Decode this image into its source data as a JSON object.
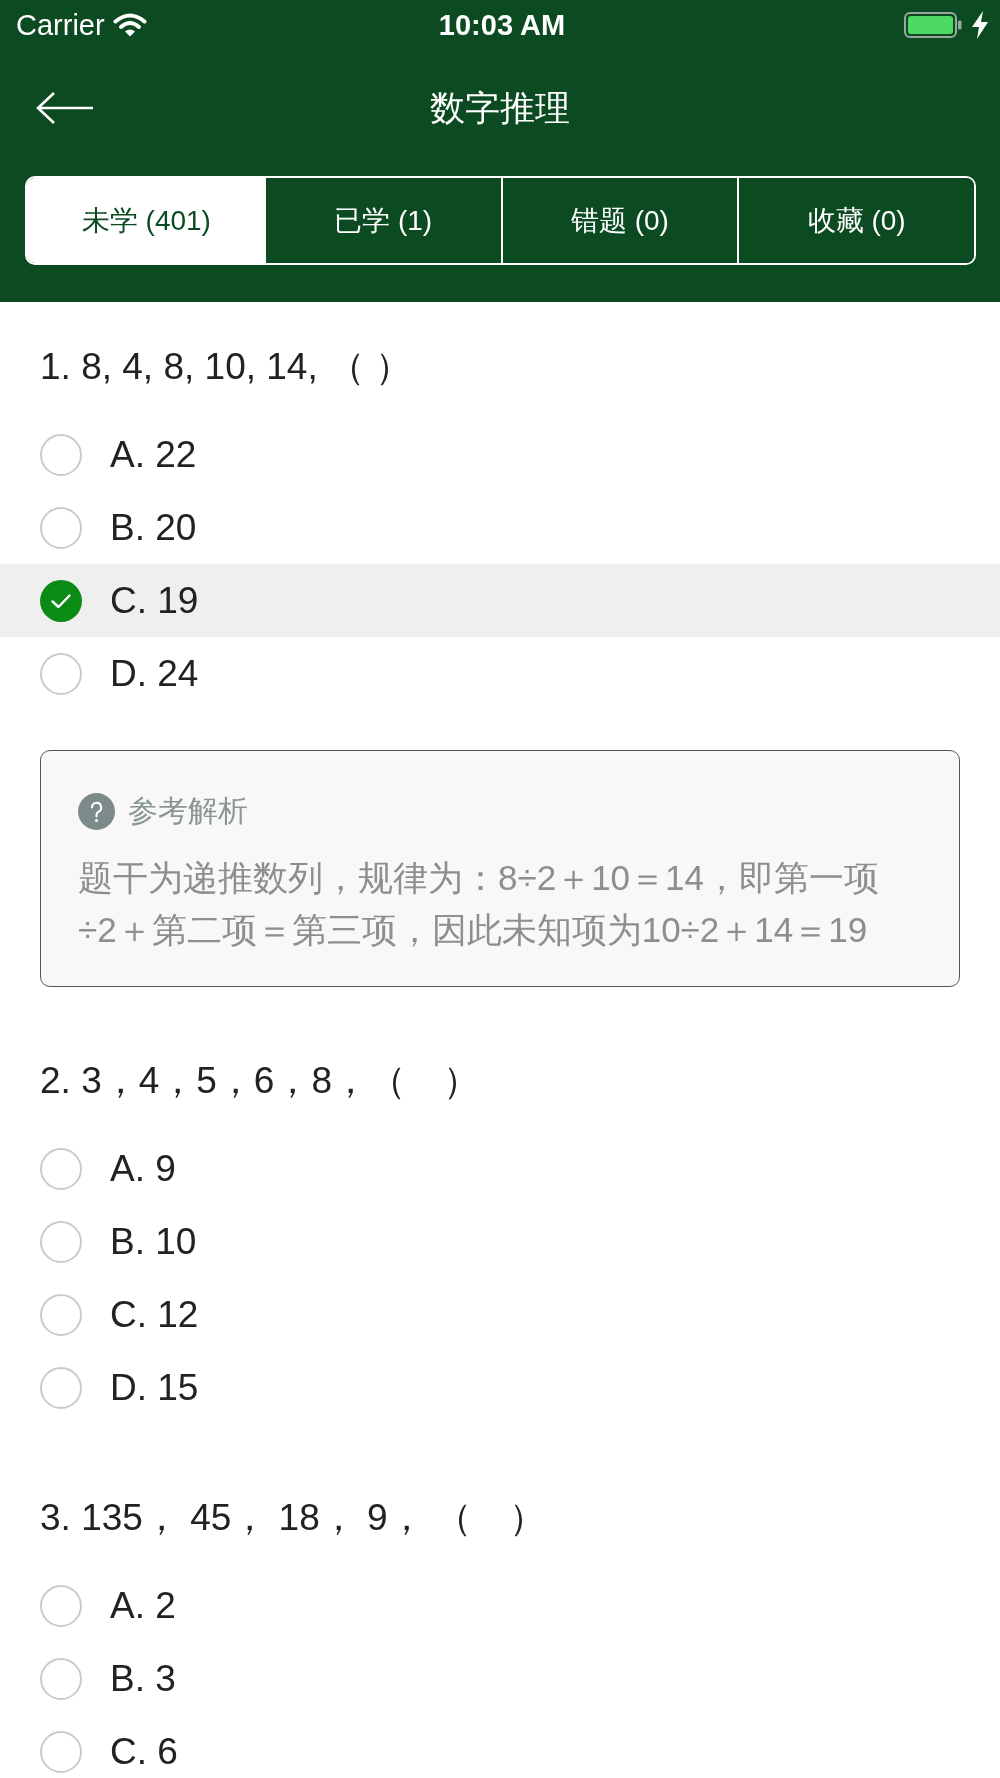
{
  "status_bar": {
    "carrier": "Carrier",
    "time": "10:03 AM"
  },
  "nav_bar": {
    "title": "数字推理"
  },
  "tabs": [
    {
      "label": "未学 (401)",
      "selected": true
    },
    {
      "label": "已学 (1)",
      "selected": false
    },
    {
      "label": "错题 (0)",
      "selected": false
    },
    {
      "label": "收藏 (0)",
      "selected": false
    }
  ],
  "questions": [
    {
      "text": "1. 8, 4, 8, 10, 14, （ ）",
      "options": [
        {
          "label": "A. 22",
          "selected": false
        },
        {
          "label": "B. 20",
          "selected": false
        },
        {
          "label": "C. 19",
          "selected": true
        },
        {
          "label": "D. 24",
          "selected": false
        }
      ],
      "explanation": {
        "title": "参考解析",
        "text": "题干为递推数列，规律为：8÷2＋10＝14，即第一项÷2＋第二项＝第三项，因此未知项为10÷2＋14＝19"
      }
    },
    {
      "text": "2. 3，4，5，6，8，（　）",
      "options": [
        {
          "label": "A. 9",
          "selected": false
        },
        {
          "label": "B. 10",
          "selected": false
        },
        {
          "label": "C. 12",
          "selected": false
        },
        {
          "label": "D. 15",
          "selected": false
        }
      ]
    },
    {
      "text": "3. 135， 45， 18， 9， （　）",
      "options": [
        {
          "label": "A. 2",
          "selected": false
        },
        {
          "label": "B. 3",
          "selected": false
        },
        {
          "label": "C. 6",
          "selected": false
        }
      ]
    }
  ]
}
